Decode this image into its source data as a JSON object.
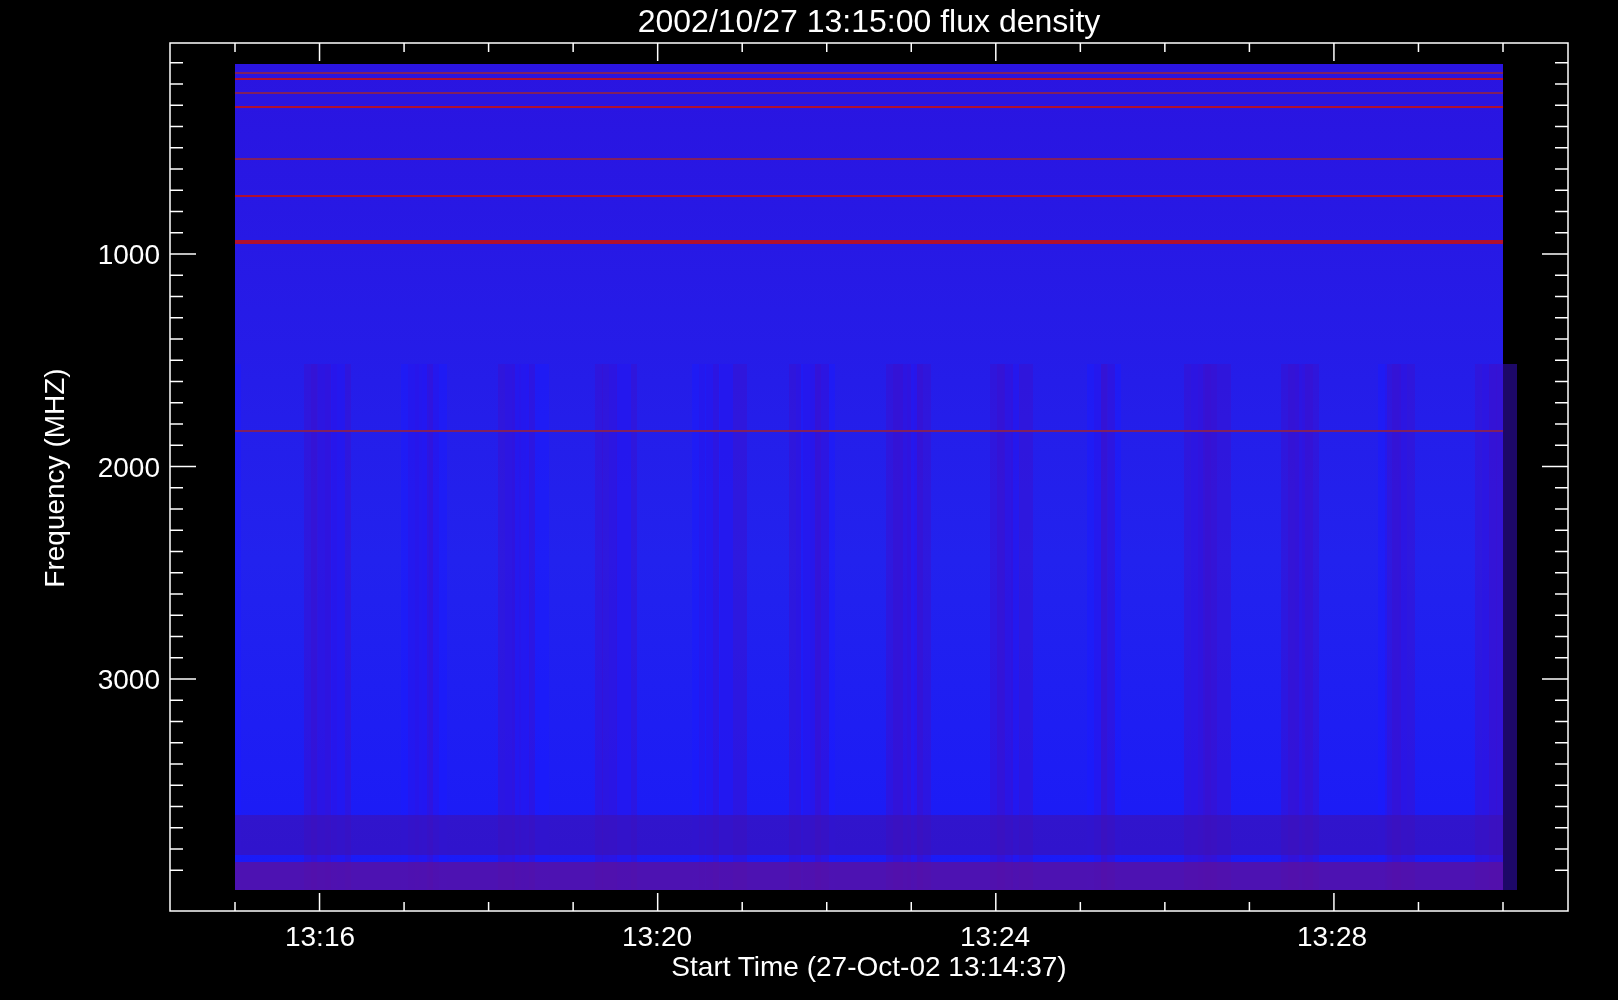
{
  "plot": {
    "title": "2002/10/27 13:15:00 flux density",
    "y_axis": {
      "label": "Frequency (MHZ)",
      "tick_labels": [
        "1000",
        "2000",
        "3000"
      ]
    },
    "x_axis": {
      "label": "Start Time (27-Oct-02 13:14:37)",
      "tick_labels": [
        "13:16",
        "13:20",
        "13:24",
        "13:28"
      ]
    }
  }
}
